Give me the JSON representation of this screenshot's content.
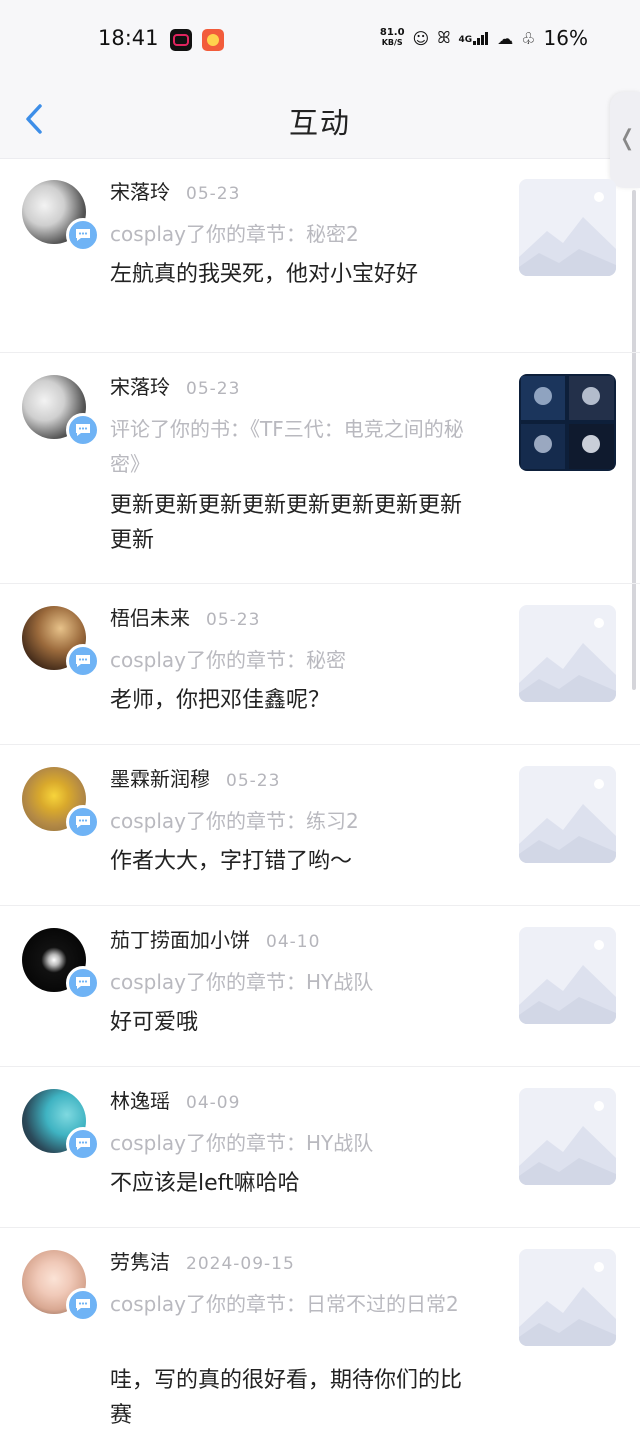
{
  "status_bar": {
    "time": "18:41",
    "net_speed_value": "81.0",
    "net_speed_unit": "KB/S",
    "signal": "4G",
    "battery": "16%"
  },
  "header": {
    "title": "互动"
  },
  "items": [
    {
      "name": "宋落玲",
      "date": "05-23",
      "action": "cosplay了你的章节：秘密2",
      "comment": "左航真的我哭死，他对小宝好好",
      "thumb": "placeholder"
    },
    {
      "name": "宋落玲",
      "date": "05-23",
      "action": "评论了你的书：《TF三代：电竞之间的秘密》",
      "comment": "更新更新更新更新更新更新更新更新更新",
      "thumb": "cover-photo"
    },
    {
      "name": "梧侣未来",
      "date": "05-23",
      "action": "cosplay了你的章节：秘密",
      "comment": "老师，你把邓佳鑫呢？",
      "thumb": "placeholder"
    },
    {
      "name": "墨霖新润穆",
      "date": "05-23",
      "action": "cosplay了你的章节：练习2",
      "comment": "作者大大，字打错了哟～",
      "thumb": "placeholder"
    },
    {
      "name": "茄丁捞面加小饼",
      "date": "04-10",
      "action": "cosplay了你的章节：HY战队",
      "comment": "好可爱哦",
      "thumb": "placeholder"
    },
    {
      "name": "林逸瑶",
      "date": "04-09",
      "action": "cosplay了你的章节：HY战队",
      "comment": "不应该是left嘛哈哈",
      "thumb": "placeholder"
    },
    {
      "name": "劳隽洁",
      "date": "2024-09-15",
      "action": "cosplay了你的章节：日常不过的日常2",
      "comment": "哇，写的真的很好看，期待你们的比赛",
      "thumb": "placeholder"
    }
  ],
  "colors": {
    "accent": "#3d8ee8",
    "badge": "#6fb3f5",
    "muted": "#b9b9bf"
  }
}
